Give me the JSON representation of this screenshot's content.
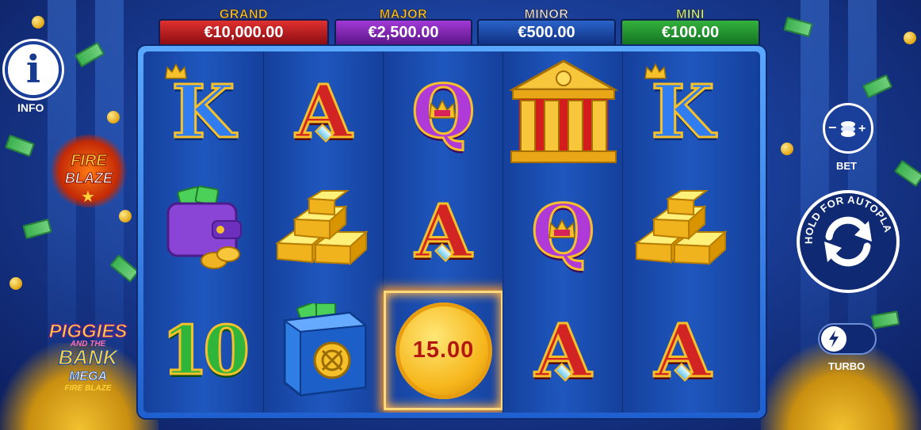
{
  "jackpots": [
    {
      "label": "GRAND",
      "value": "€10,000.00",
      "color": "#b3171b"
    },
    {
      "label": "MAJOR",
      "value": "€2,500.00",
      "color": "#7b22b0"
    },
    {
      "label": "MINOR",
      "value": "€500.00",
      "color": "#1d4aa8"
    },
    {
      "label": "MINI",
      "value": "€100.00",
      "color": "#1f8f2c"
    }
  ],
  "reels": [
    [
      "K",
      "wallet",
      "10"
    ],
    [
      "A",
      "gold-bars",
      "safe"
    ],
    [
      "Q",
      "A",
      "coin"
    ],
    [
      "bank",
      "Q",
      "A"
    ],
    [
      "K",
      "gold-bars",
      "A"
    ]
  ],
  "coin_value": "15.00",
  "left_panel": {
    "info_label": "INFO",
    "fire_blaze_logo": [
      "FIRE",
      "BLAZE"
    ],
    "game_logo": [
      "PIGGIES",
      "AND THE",
      "BANK",
      "MEGA",
      "FIRE BLAZE"
    ]
  },
  "right_panel": {
    "bet_label": "BET",
    "autoplay_label": "HOLD FOR AUTOPLAY",
    "turbo_label": "TURBO"
  },
  "colors": {
    "background": "#1a3f9a",
    "gold": "#f5c02a",
    "coin_text": "#b2180f"
  }
}
